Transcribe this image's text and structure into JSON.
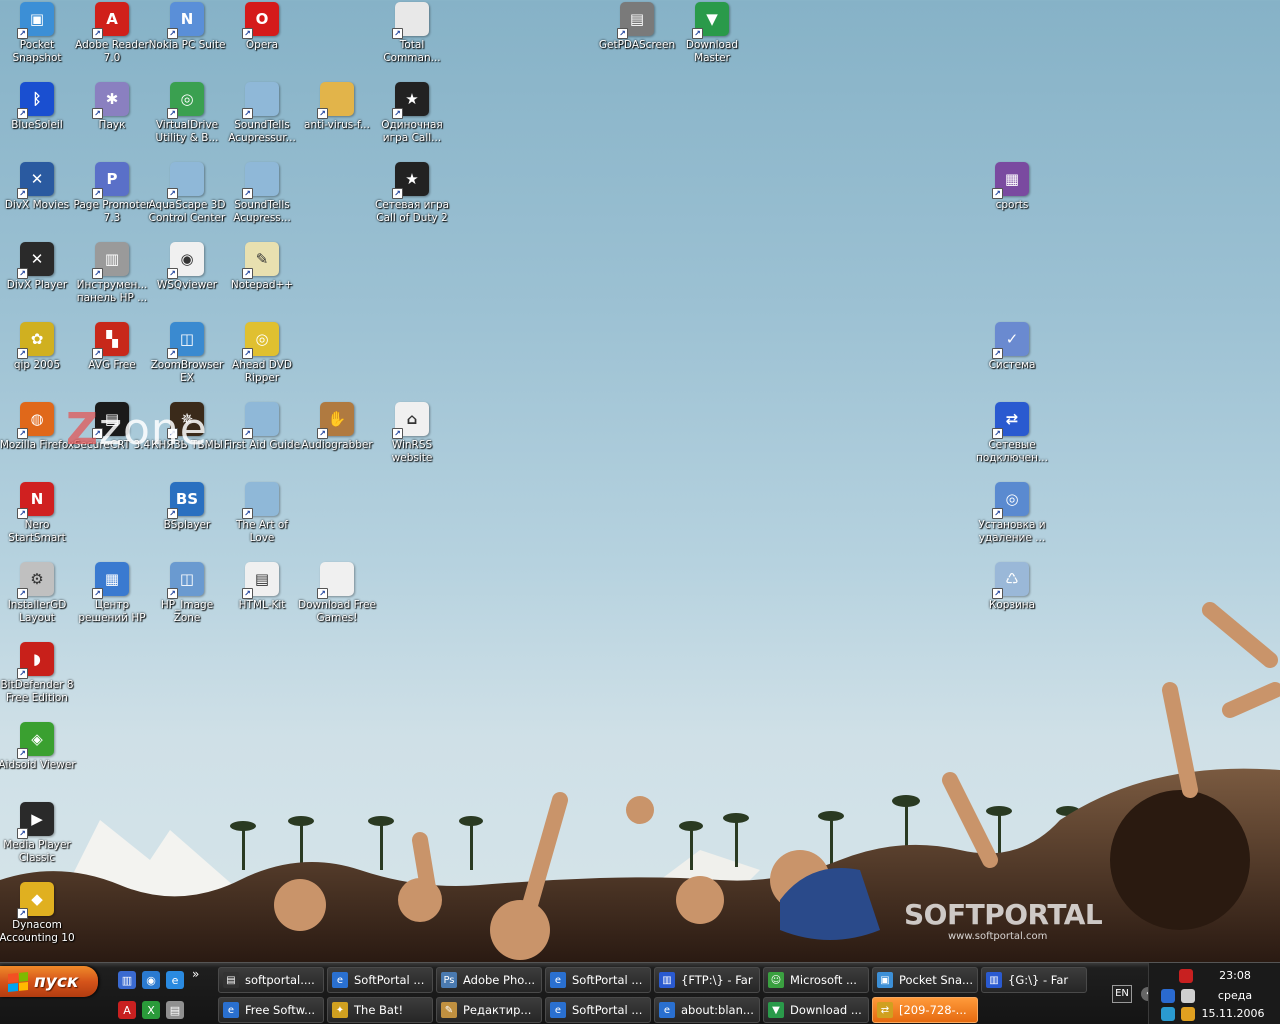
{
  "desktop": {
    "icons": [
      {
        "label": "Pocket Snapshot",
        "icon": "pda-camera-icon",
        "color": "#3c8fd6",
        "glyph": "▣"
      },
      {
        "label": "Adobe Reader 7.0",
        "icon": "adobe-reader-icon",
        "color": "#d0201a",
        "glyph": "A"
      },
      {
        "label": "Nokia PC Suite",
        "icon": "nokia-suite-icon",
        "color": "#5a8fd8",
        "glyph": "N"
      },
      {
        "label": "Opera",
        "icon": "opera-icon",
        "color": "#d51a1a",
        "glyph": "O"
      },
      {
        "label": "Total Comman...",
        "icon": "document-icon",
        "color": "#e8e8e8",
        "glyph": ""
      },
      {
        "label": "GetPDAScreen",
        "icon": "pda-icon",
        "color": "#7a7a7a",
        "glyph": "▤"
      },
      {
        "label": "Download Master",
        "icon": "download-master-icon",
        "color": "#2a9a4a",
        "glyph": "▼"
      },
      {
        "label": "BlueSoleil",
        "icon": "bluetooth-icon",
        "color": "#1a4fd0",
        "glyph": "ᛒ"
      },
      {
        "label": "Паук",
        "icon": "spider-icon",
        "color": "#8a80c0",
        "glyph": "✱"
      },
      {
        "label": "VirtualDrive Utility & B...",
        "icon": "virtual-drive-icon",
        "color": "#3aa050",
        "glyph": "◎"
      },
      {
        "label": "SoundTells Acupressur...",
        "icon": "app-window-icon",
        "color": "#8fb8d8",
        "glyph": ""
      },
      {
        "label": "anti-virus-f...",
        "icon": "folder-icon",
        "color": "#e2b44a",
        "glyph": ""
      },
      {
        "label": "Одиночная игра Call...",
        "icon": "call-of-duty-icon",
        "color": "#222222",
        "glyph": "★"
      },
      {
        "label": "DivX Movies",
        "icon": "divx-movies-icon",
        "color": "#2a5aa0",
        "glyph": "✕"
      },
      {
        "label": "Page Promoter 7.3",
        "icon": "page-promoter-icon",
        "color": "#5a70c8",
        "glyph": "P"
      },
      {
        "label": "AquaScape 3D Control Center",
        "icon": "app-window-icon",
        "color": "#8fb8d8",
        "glyph": ""
      },
      {
        "label": "SoundTells Acupress...",
        "icon": "app-window-icon",
        "color": "#8fb8d8",
        "glyph": ""
      },
      {
        "label": "Сетевая игра Call of Duty 2",
        "icon": "call-of-duty-icon",
        "color": "#222222",
        "glyph": "★"
      },
      {
        "label": "cports",
        "icon": "network-ports-icon",
        "color": "#7a4aa0",
        "glyph": "▦"
      },
      {
        "label": "DivX Player",
        "icon": "divx-player-icon",
        "color": "#2a2a2a",
        "glyph": "✕"
      },
      {
        "label": "Инструмен... панель HP ...",
        "icon": "hp-toolbox-icon",
        "color": "#9a9a9a",
        "glyph": "▥"
      },
      {
        "label": "WSQviewer",
        "icon": "eye-icon",
        "color": "#f0f0f0",
        "glyph": "◉"
      },
      {
        "label": "Notepad++",
        "icon": "notepad-icon",
        "color": "#e8e0b0",
        "glyph": "✎"
      },
      {
        "label": "qip 2005",
        "icon": "qip-icon",
        "color": "#d0b020",
        "glyph": "✿"
      },
      {
        "label": "AVG Free",
        "icon": "avg-icon",
        "color": "#c8281a",
        "glyph": "▚"
      },
      {
        "label": "ZoomBrowser EX",
        "icon": "zoombrowser-icon",
        "color": "#3a8ad0",
        "glyph": "◫"
      },
      {
        "label": "Ahead DVD Ripper",
        "icon": "dvd-ripper-icon",
        "color": "#e0c030",
        "glyph": "◎"
      },
      {
        "label": "Система",
        "icon": "system-icon",
        "color": "#6a8ad0",
        "glyph": "✓"
      },
      {
        "label": "Mozilla Firefox",
        "icon": "firefox-icon",
        "color": "#e0681a",
        "glyph": "◍"
      },
      {
        "label": "SecureCRT 3.4",
        "icon": "terminal-icon",
        "color": "#1a1a1a",
        "glyph": "▤"
      },
      {
        "label": "КНЯЗЬ ТЬМЫ",
        "icon": "game-icon",
        "color": "#3a2a1a",
        "glyph": "✵"
      },
      {
        "label": "First Aid Guide",
        "icon": "app-window-icon",
        "color": "#8fb8d8",
        "glyph": ""
      },
      {
        "label": "Audiograbber",
        "icon": "audiograbber-icon",
        "color": "#b07a40",
        "glyph": "✋"
      },
      {
        "label": "WinRSS website",
        "icon": "web-link-icon",
        "color": "#f0f0f0",
        "glyph": "⌂"
      },
      {
        "label": "Сетевые подключен...",
        "icon": "network-connections-icon",
        "color": "#2a5ad0",
        "glyph": "⇄"
      },
      {
        "label": "Nero StartSmart",
        "icon": "nero-icon",
        "color": "#d02020",
        "glyph": "N"
      },
      {
        "label": "BSplayer",
        "icon": "bsplayer-icon",
        "color": "#2a70c0",
        "glyph": "BS"
      },
      {
        "label": "The Art of Love",
        "icon": "app-window-icon",
        "color": "#8fb8d8",
        "glyph": ""
      },
      {
        "label": "Установка и удаление ...",
        "icon": "add-remove-programs-icon",
        "color": "#5a8ad0",
        "glyph": "◎"
      },
      {
        "label": "InstallerGD Layout",
        "icon": "installer-icon",
        "color": "#c0c0c0",
        "glyph": "⚙"
      },
      {
        "label": "Центр решений HP",
        "icon": "hp-center-icon",
        "color": "#3a7ad0",
        "glyph": "▦"
      },
      {
        "label": "HP_Image Zone",
        "icon": "hp-image-zone-icon",
        "color": "#6a9ad0",
        "glyph": "◫"
      },
      {
        "label": "HTML-Kit",
        "icon": "html-kit-icon",
        "color": "#f0f0f0",
        "glyph": "▤"
      },
      {
        "label": "Download Free Games!",
        "icon": "document-icon",
        "color": "#f0f0f0",
        "glyph": ""
      },
      {
        "label": "Корзина",
        "icon": "recycle-bin-icon",
        "color": "#9ab8d8",
        "glyph": "♺"
      },
      {
        "label": "BitDefender 8 Free Edition",
        "icon": "bitdefender-icon",
        "color": "#c8201a",
        "glyph": "◗"
      },
      {
        "label": "Aidsoid Viewer",
        "icon": "aidsoid-icon",
        "color": "#3aa030",
        "glyph": "◈"
      },
      {
        "label": "Media Player Classic",
        "icon": "media-player-icon",
        "color": "#2a2a2a",
        "glyph": "▶"
      },
      {
        "label": "Dynacom Accounting 10",
        "icon": "dynacom-icon",
        "color": "#e0b020",
        "glyph": "◆"
      }
    ],
    "watermark_zone": "zone",
    "watermark_soft": "SOFTPORTAL",
    "watermark_url": "www.softportal.com"
  },
  "taskbar": {
    "start_label": "пуск",
    "quicklaunch": [
      {
        "icon": "show-desktop-icon",
        "color": "#3a6ad0"
      },
      {
        "icon": "windows-media-icon",
        "color": "#2a7ad0"
      },
      {
        "icon": "internet-explorer-icon",
        "color": "#2a8ae0"
      },
      {
        "icon": "acrobat-icon",
        "color": "#c82020"
      },
      {
        "icon": "excel-icon",
        "color": "#2a9a3a"
      },
      {
        "icon": "scanner-icon",
        "color": "#909090"
      }
    ],
    "more": "»",
    "tasks": [
      {
        "label": "softportal....",
        "icon": "terminal-icon",
        "color": "#333333"
      },
      {
        "label": "SoftPortal ...",
        "icon": "ie-page-icon",
        "color": "#2a70d0"
      },
      {
        "label": "Adobe Pho...",
        "icon": "photoshop-icon",
        "color": "#4a7ab0"
      },
      {
        "label": "SoftPortal ...",
        "icon": "ie-page-icon",
        "color": "#2a70d0"
      },
      {
        "label": "{FTP:\\} - Far",
        "icon": "far-manager-icon",
        "color": "#2a5ad0"
      },
      {
        "label": "Microsoft ...",
        "icon": "messenger-icon",
        "color": "#3aa040"
      },
      {
        "label": "Pocket Sna...",
        "icon": "pda-camera-icon",
        "color": "#3c8fd6"
      },
      {
        "label": "{G:\\} - Far",
        "icon": "far-manager-icon",
        "color": "#2a5ad0"
      },
      {
        "label": "Free Softw...",
        "icon": "ie-page-icon",
        "color": "#2a70d0"
      },
      {
        "label": "The Bat!",
        "icon": "the-bat-icon",
        "color": "#d0a020"
      },
      {
        "label": "Редактир...",
        "icon": "editor-icon",
        "color": "#c09040"
      },
      {
        "label": "SoftPortal ...",
        "icon": "ie-page-icon",
        "color": "#2a70d0"
      },
      {
        "label": "about:blan...",
        "icon": "ie-page-icon",
        "color": "#2a70d0"
      },
      {
        "label": "Download ...",
        "icon": "download-master-icon",
        "color": "#2a9a4a"
      },
      {
        "label": "[209-728-...",
        "icon": "transfer-icon",
        "color": "#d0a020"
      }
    ],
    "lang": "EN",
    "time": "23:08",
    "day": "среда",
    "date": "15.11.2006",
    "tray_icons": [
      {
        "icon": "tray-app-icon",
        "color": "#c82020"
      },
      {
        "icon": "tray-eye-icon",
        "color": "#2a6ad0"
      },
      {
        "icon": "tray-network-icon",
        "color": "#cfcfcf"
      },
      {
        "icon": "tray-globe-icon",
        "color": "#2a9ad0"
      },
      {
        "icon": "tray-shield-icon",
        "color": "#e0a020"
      }
    ]
  }
}
